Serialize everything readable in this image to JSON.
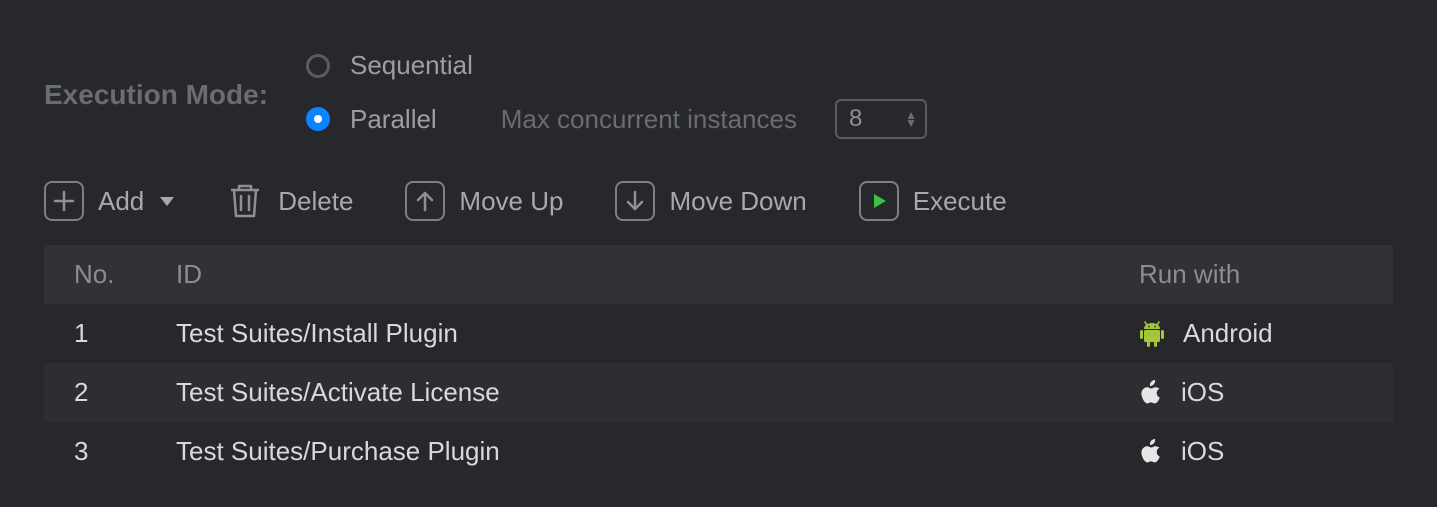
{
  "executionMode": {
    "label": "Execution Mode:",
    "options": {
      "sequential": "Sequential",
      "parallel": "Parallel"
    },
    "maxConcurrentLabel": "Max concurrent instances",
    "maxConcurrentValue": "8"
  },
  "toolbar": {
    "add": "Add",
    "delete": "Delete",
    "moveUp": "Move Up",
    "moveDown": "Move Down",
    "execute": "Execute"
  },
  "table": {
    "headers": {
      "no": "No.",
      "id": "ID",
      "runWith": "Run with"
    },
    "rows": [
      {
        "no": "1",
        "id": "Test Suites/Install Plugin",
        "runWith": "Android",
        "platform": "android"
      },
      {
        "no": "2",
        "id": "Test Suites/Activate License",
        "runWith": "iOS",
        "platform": "ios"
      },
      {
        "no": "3",
        "id": "Test Suites/Purchase Plugin",
        "runWith": "iOS",
        "platform": "ios"
      }
    ]
  }
}
